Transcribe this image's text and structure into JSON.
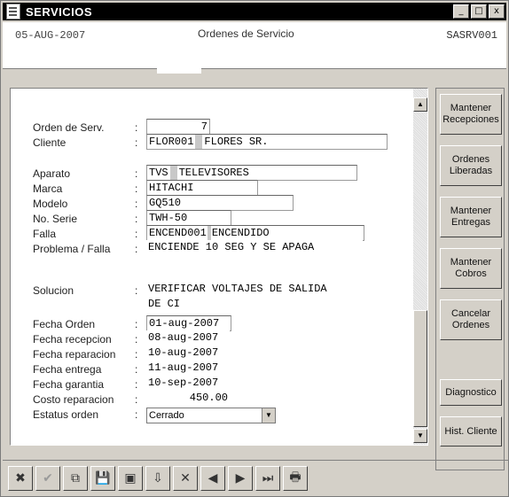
{
  "window": {
    "title": "SERVICIOS",
    "controls": {
      "min": "_",
      "max": "□",
      "close": "x"
    }
  },
  "header": {
    "date": "05-AUG-2007",
    "title": "Ordenes de Servicio",
    "code": "SASRV001"
  },
  "form": {
    "orden": {
      "label": "Orden de Serv.",
      "value": "7"
    },
    "cliente": {
      "label": "Cliente",
      "code": "FLOR001",
      "name": "FLORES SR."
    },
    "aparato": {
      "label": "Aparato",
      "code": "TVS",
      "name": "TELEVISORES"
    },
    "marca": {
      "label": "Marca",
      "value": "HITACHI"
    },
    "modelo": {
      "label": "Modelo",
      "value": "GQ510"
    },
    "serie": {
      "label": "No. Serie",
      "value": "TWH-50"
    },
    "falla": {
      "label": "Falla",
      "code": "ENCEND001",
      "name": "ENCENDIDO"
    },
    "problema": {
      "label": "Problema / Falla",
      "value": "ENCIENDE 10 SEG Y SE APAGA"
    },
    "solucion": {
      "label": "Solucion",
      "line1": "VERIFICAR VOLTAJES DE SALIDA",
      "line2": "DE CI"
    },
    "fecha_orden": {
      "label": "Fecha Orden",
      "value": "01-aug-2007"
    },
    "fecha_recepcion": {
      "label": "Fecha recepcion",
      "value": "08-aug-2007"
    },
    "fecha_reparacion": {
      "label": "Fecha reparacion",
      "value": "10-aug-2007"
    },
    "fecha_entrega": {
      "label": "Fecha entrega",
      "value": "11-aug-2007"
    },
    "fecha_garantia": {
      "label": "Fecha garantia",
      "value": "10-sep-2007"
    },
    "costo": {
      "label": "Costo reparacion",
      "value": "450.00"
    },
    "estatus": {
      "label": "Estatus orden",
      "value": "Cerrado"
    }
  },
  "colon": ":",
  "scroll": {
    "up": "▲",
    "down": "▼"
  },
  "sidebar": {
    "mantener_recepciones": "Mantener Recepciones",
    "ordenes_liberadas": "Ordenes Liberadas",
    "mantener_entregas": "Mantener Entregas",
    "mantener_cobros": "Mantener Cobros",
    "cancelar_ordenes": "Cancelar Ordenes",
    "diagnostico": "Diagnostico",
    "hist_cliente": "Hist. Cliente"
  },
  "toolbar": {
    "cancel": "✖",
    "accept": "✔",
    "copy": "⧉",
    "save": "💾",
    "clear": "▣",
    "insert": "⇩",
    "delete": "✕",
    "prev": "◀",
    "next": "▶",
    "last": "⏭",
    "print": "🖶"
  }
}
